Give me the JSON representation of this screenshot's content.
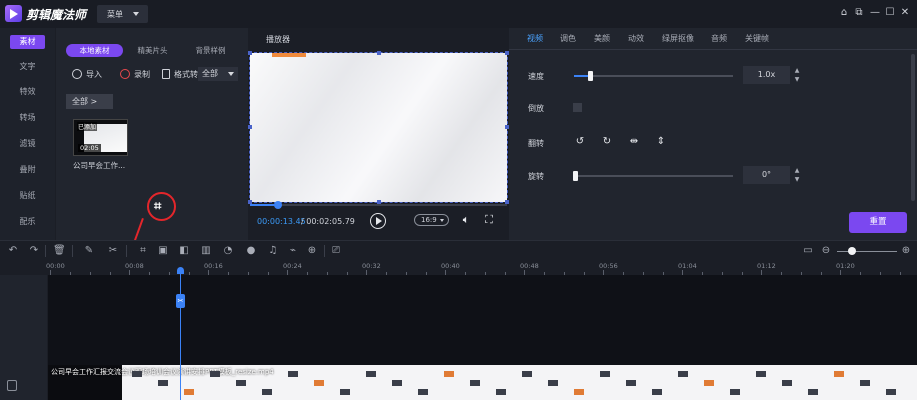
{
  "titlebar": {
    "app_title": "剪辑魔法师",
    "menu_label": "菜单"
  },
  "window_controls": {
    "home": "⌂",
    "restore": "⧉",
    "minimize": "—",
    "maximize": "☐",
    "close": "✕"
  },
  "categories": [
    "素材",
    "文字",
    "特效",
    "转场",
    "滤镜",
    "叠附",
    "贴纸",
    "配乐"
  ],
  "active_category": "素材",
  "material_tabs": [
    "本地素材",
    "精美片头",
    "背景样例"
  ],
  "material_tools": {
    "import": "导入",
    "record": "录制",
    "format": "格式转",
    "format_value": "全部"
  },
  "filter": "全部 >",
  "media_item": {
    "badge": "已添加",
    "duration": "02:05",
    "caption": "公司早会工作..."
  },
  "player": {
    "title": "播放器",
    "current_time": "00:00:13.45",
    "total_time": " / 00:02:05.79",
    "ratio": "16:9",
    "progress": 0.108
  },
  "props_tabs": [
    "视频",
    "调色",
    "美颜",
    "动效",
    "绿屏抠像",
    "音频",
    "关键帧"
  ],
  "active_props_tab": "视频",
  "props": {
    "speed_label": "速度",
    "speed_value": "1.0x",
    "speed_level": 0.1,
    "reverse_label": "倒放",
    "flip_label": "翻转",
    "rotate_label": "旋转",
    "rotate_value": "0°",
    "rotate_level": 0.0,
    "reset_label": "重置"
  },
  "ruler_ticks": [
    "00:00",
    "00:08",
    "00:16",
    "00:24",
    "00:32",
    "00:40",
    "00:48",
    "00:56",
    "01:04",
    "01:12",
    "01:20"
  ],
  "clip_name": "公司早会工作汇报交流会议职场培训会议演讲安排PPT模板_resize.mp4",
  "colors": {
    "accent": "#7b48f0",
    "blue": "#3b82f6",
    "annotation": "#e3262b"
  }
}
